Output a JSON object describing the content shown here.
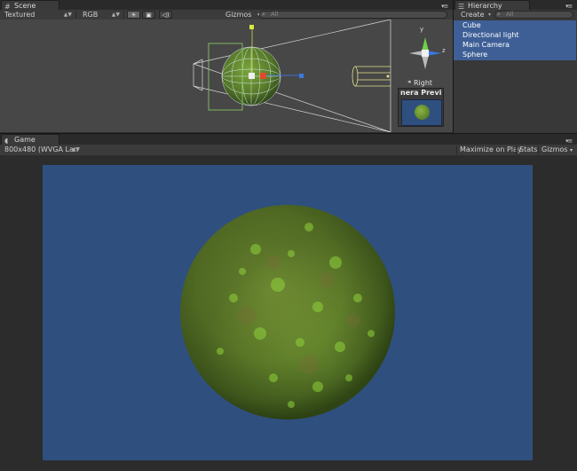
{
  "scene": {
    "tab_label": "Scene",
    "render_mode": "Textured",
    "color_mode": "RGB",
    "gizmos_label": "Gizmos",
    "search_placeholder": "All",
    "view_label": "Right",
    "camera_preview_label": "nera Previ",
    "gizmo_axes": {
      "y": "y",
      "z": "z"
    }
  },
  "hierarchy": {
    "tab_label": "Hierarchy",
    "create_label": "Create",
    "search_placeholder": "All",
    "items": [
      "Cube",
      "Directional light",
      "Main Camera",
      "Sphere"
    ]
  },
  "game": {
    "tab_label": "Game",
    "resolution": "800x480 (WVGA Lan",
    "maximize_label": "Maximize on Play",
    "stats_label": "Stats",
    "gizmos_label": "Gizmos"
  },
  "colors": {
    "selection": "#3e5f96",
    "viewport_bg": "#2f4f7f",
    "editor_bg": "#474747",
    "sphere_green": "#6f9a33"
  },
  "icons": {
    "sun": "sun-icon",
    "image": "image-icon",
    "audio": "audio-icon",
    "menu": "panel-menu-icon",
    "search": "search-icon"
  }
}
